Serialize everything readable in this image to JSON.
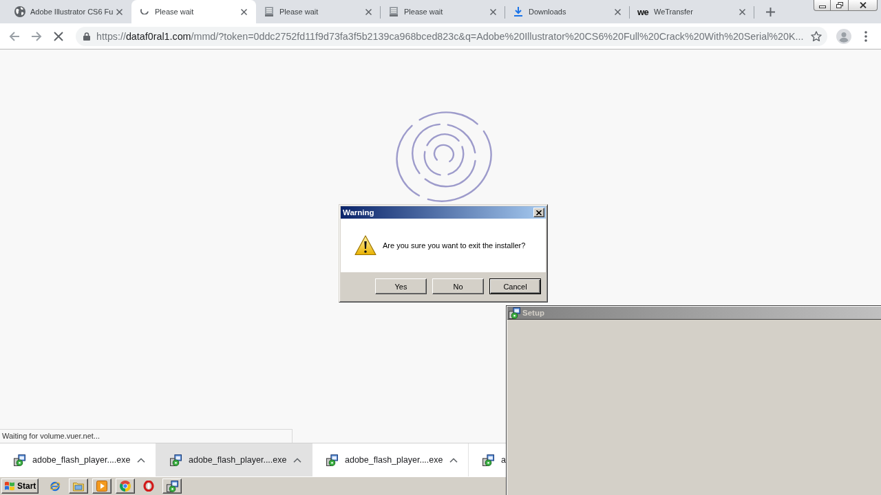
{
  "browser": {
    "tabs": [
      {
        "kind": "site",
        "title": "Adobe Illustrator CS6 Fu",
        "selected": false
      },
      {
        "kind": "loading",
        "title": "Please wait",
        "selected": true
      },
      {
        "kind": "page",
        "title": "Please wait",
        "selected": false
      },
      {
        "kind": "page",
        "title": "Please wait",
        "selected": false
      },
      {
        "kind": "downloads",
        "title": "Downloads",
        "selected": false
      },
      {
        "kind": "logo",
        "logo": "we",
        "title": "WeTransfer",
        "selected": false
      }
    ],
    "address_bar": {
      "url_scheme": "https://",
      "url_host": "dataf0ral1.com",
      "url_rest": "/mmd/?token=0ddc2752fd11f9d73fa3f5b2139ca968bced823c&q=Adobe%20Illustrator%20CS6%20Full%20Crack%20With%20Serial%20K..."
    },
    "status": "Waiting for volume.vuer.net...",
    "downloads": [
      {
        "name": "adobe_flash_player....exe",
        "hovered": false
      },
      {
        "name": "adobe_flash_player....exe",
        "hovered": true
      },
      {
        "name": "adobe_flash_player....exe",
        "hovered": false
      },
      {
        "name": "a",
        "hovered": false
      }
    ]
  },
  "dialog": {
    "title": "Warning",
    "message": "Are you sure you want to exit the installer?",
    "buttons": [
      {
        "label": "Yes",
        "focused": false
      },
      {
        "label": "No",
        "focused": false
      },
      {
        "label": "Cancel",
        "focused": true
      }
    ]
  },
  "setup_window": {
    "title": "Setup"
  },
  "taskbar": {
    "start": "Start",
    "items": [
      {
        "kind": "web",
        "raised": false
      },
      {
        "kind": "folder",
        "raised": true
      },
      {
        "kind": "media",
        "raised": true
      },
      {
        "kind": "wheel",
        "raised": true
      },
      {
        "kind": "ring",
        "raised": false
      },
      {
        "kind": "setup",
        "raised": true
      }
    ]
  }
}
